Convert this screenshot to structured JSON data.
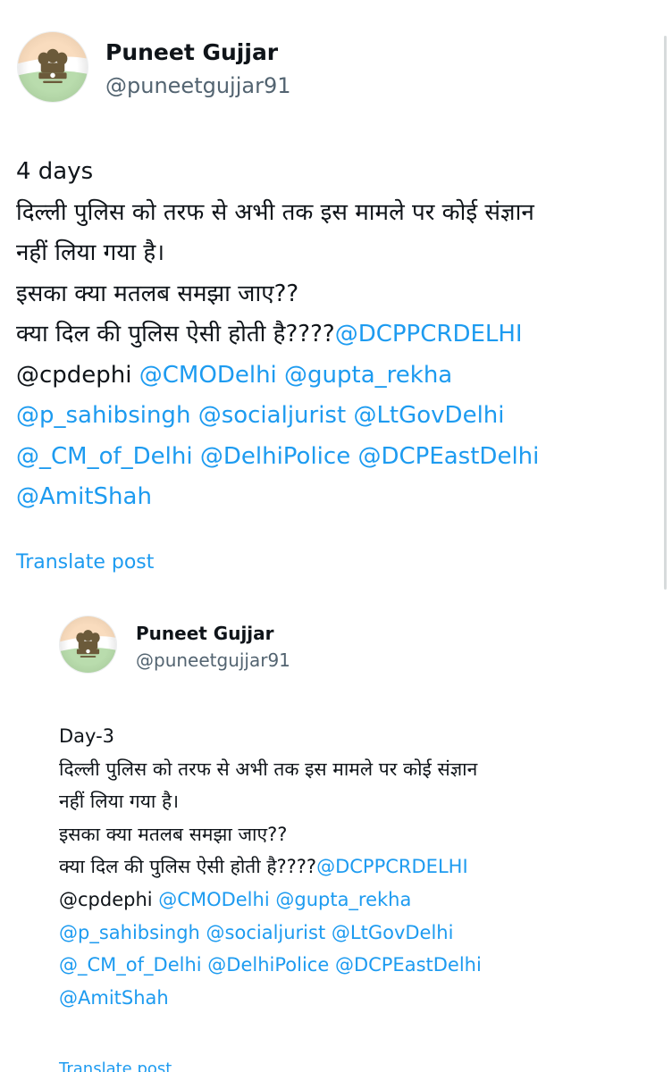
{
  "main_post": {
    "author_name": "Puneet Gujjar",
    "author_handle": "@puneetgujjar91",
    "avatar_icon": "ashoka-emblem-icon",
    "lines": [
      [
        {
          "text": "4 days",
          "type": "plain"
        }
      ],
      [
        {
          "text": "दिल्ली पुलिस को तरफ से अभी तक इस मामले पर कोई संज्ञान",
          "type": "plain"
        }
      ],
      [
        {
          "text": "नहीं लिया गया है।",
          "type": "plain"
        }
      ],
      [
        {
          "text": "इसका क्या मतलब समझा जाए??",
          "type": "plain"
        }
      ],
      [
        {
          "text": "क्या दिल की पुलिस ऐसी होती है????",
          "type": "plain"
        },
        {
          "text": "@DCPPCRDELHI",
          "type": "mention"
        }
      ],
      [
        {
          "text": "@cpdephi ",
          "type": "plain"
        },
        {
          "text": "@CMODelhi",
          "type": "mention"
        },
        {
          "text": " ",
          "type": "plain"
        },
        {
          "text": "@gupta_rekha",
          "type": "mention"
        }
      ],
      [
        {
          "text": "@p_sahibsingh",
          "type": "mention"
        },
        {
          "text": " ",
          "type": "plain"
        },
        {
          "text": "@socialjurist",
          "type": "mention"
        },
        {
          "text": " ",
          "type": "plain"
        },
        {
          "text": "@LtGovDelhi",
          "type": "mention"
        }
      ],
      [
        {
          "text": "@_CM_of_Delhi",
          "type": "mention"
        },
        {
          "text": " ",
          "type": "plain"
        },
        {
          "text": "@DelhiPolice",
          "type": "mention"
        },
        {
          "text": " ",
          "type": "plain"
        },
        {
          "text": "@DCPEastDelhi",
          "type": "mention"
        }
      ],
      [
        {
          "text": "@AmitShah",
          "type": "mention"
        }
      ]
    ],
    "translate_label": "Translate post"
  },
  "quoted_post": {
    "author_name": "Puneet Gujjar",
    "author_handle": "@puneetgujjar91",
    "avatar_icon": "ashoka-emblem-icon",
    "lines": [
      [
        {
          "text": "Day-3",
          "type": "plain"
        }
      ],
      [
        {
          "text": "दिल्ली पुलिस को तरफ से अभी तक इस मामले पर कोई संज्ञान",
          "type": "plain"
        }
      ],
      [
        {
          "text": "नहीं लिया गया है।",
          "type": "plain"
        }
      ],
      [
        {
          "text": "इसका क्या मतलब समझा जाए??",
          "type": "plain"
        }
      ],
      [
        {
          "text": "क्या दिल की पुलिस ऐसी होती है????",
          "type": "plain"
        },
        {
          "text": "@DCPPCRDELHI",
          "type": "mention"
        }
      ],
      [
        {
          "text": "@cpdephi ",
          "type": "plain"
        },
        {
          "text": "@CMODelhi",
          "type": "mention"
        },
        {
          "text": " ",
          "type": "plain"
        },
        {
          "text": "@gupta_rekha",
          "type": "mention"
        }
      ],
      [
        {
          "text": "@p_sahibsingh",
          "type": "mention"
        },
        {
          "text": " ",
          "type": "plain"
        },
        {
          "text": "@socialjurist",
          "type": "mention"
        },
        {
          "text": " ",
          "type": "plain"
        },
        {
          "text": "@LtGovDelhi",
          "type": "mention"
        }
      ],
      [
        {
          "text": "@_CM_of_Delhi",
          "type": "mention"
        },
        {
          "text": " ",
          "type": "plain"
        },
        {
          "text": "@DelhiPolice",
          "type": "mention"
        },
        {
          "text": " ",
          "type": "plain"
        },
        {
          "text": "@DCPEastDelhi",
          "type": "mention"
        }
      ],
      [
        {
          "text": "@AmitShah",
          "type": "mention"
        }
      ]
    ],
    "translate_label": "Translate post"
  },
  "colors": {
    "text": "#0f1419",
    "secondary": "#536471",
    "link": "#1d9bf0",
    "background": "#ffffff"
  }
}
